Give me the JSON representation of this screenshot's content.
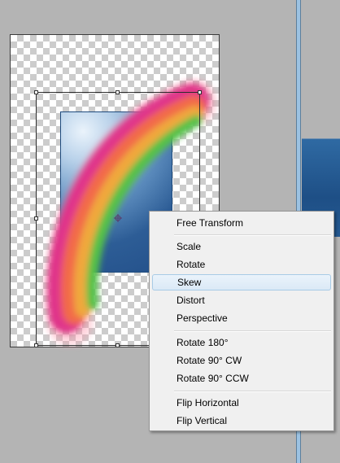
{
  "context_menu": {
    "items": [
      {
        "label": "Free Transform"
      },
      {
        "label": "Scale"
      },
      {
        "label": "Rotate"
      },
      {
        "label": "Skew",
        "highlighted": true
      },
      {
        "label": "Distort"
      },
      {
        "label": "Perspective"
      },
      {
        "label": "Rotate 180°"
      },
      {
        "label": "Rotate 90° CW"
      },
      {
        "label": "Rotate 90° CCW"
      },
      {
        "label": "Flip Horizontal"
      },
      {
        "label": "Flip Vertical"
      }
    ]
  },
  "colors": {
    "workspace": "#b4b4b4",
    "menu_background": "#f0f0f0",
    "menu_highlight": "#dbe9f6",
    "panel_divider": "#9cc2e2"
  },
  "icons": [
    "transform-center-icon",
    "transform-handle-icon"
  ]
}
